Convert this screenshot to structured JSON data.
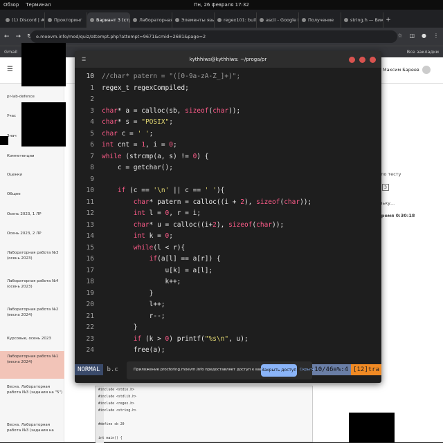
{
  "os": {
    "menu": "Обзор",
    "app": "Терминал",
    "clock": "Пн, 26 февраля 17:32"
  },
  "tabs": [
    {
      "label": "(1) Discord | #pr-2"
    },
    {
      "label": "Прокторинг"
    },
    {
      "label": "Вариант 3 (стр"
    },
    {
      "label": "Лабораторная"
    },
    {
      "label": "Элементы язы"
    },
    {
      "label": "regex101: build,"
    },
    {
      "label": "ascii - Google П"
    },
    {
      "label": "Получение"
    },
    {
      "label": "string.h — Вики"
    }
  ],
  "address": {
    "url": "e.moevm.info/mod/quiz/attempt.php?attempt=9671&cmid=2681&page=2"
  },
  "bookmarks": {
    "gmail": "Gmail",
    "all": "Все закладки"
  },
  "moodle": {
    "user": "Максим Бареев",
    "sidebar": [
      "pr-lab-defence",
      "Учас",
      "Знач",
      "Компетенции",
      "Оценки",
      "Общее",
      "Осень 2023, 1 ЛР",
      "Осень 2023, 2 ЛР",
      "Лабораторная работа №3 (осень 2023)",
      "Лабораторная работа №4 (осень 2023)",
      "Лабораторная работа №2 (весна 2024)",
      "Курсовые, осень 2023",
      "Лабораторная работа №1 (весна 2024)",
      "Весна. Лабораторная работа №3 (задания на \"5\")",
      "Весна. Лабораторная работа №3 (задания на"
    ],
    "right": {
      "l1": "ия по тесту",
      "l2": "3",
      "l3": "польку...",
      "l4": "е время 0:30:18"
    }
  },
  "terminal": {
    "title": "kythhiws@kythhiws: ~/proga/pr",
    "lines": [
      {
        "n": "10",
        "t": "//char* patern = \"([0-9a-zA-Z_]+)\";"
      },
      {
        "n": "1",
        "t": "regex_t regexCompiled;"
      },
      {
        "n": "2",
        "t": ""
      },
      {
        "n": "3",
        "t": "char* a = calloc(sb, sizeof(char));"
      },
      {
        "n": "4",
        "t": "char* s = \"POSIX\";"
      },
      {
        "n": "5",
        "t": "char c = ' ';"
      },
      {
        "n": "6",
        "t": "int cnt = 1, i = 0;"
      },
      {
        "n": "7",
        "t": "while (strcmp(a, s) != 0) {"
      },
      {
        "n": "8",
        "t": "    c = getchar();"
      },
      {
        "n": "9",
        "t": ""
      },
      {
        "n": "10",
        "t": "    if (c == '\\n' || c == ' '){"
      },
      {
        "n": "11",
        "t": "        char* patern = calloc((i + 2), sizeof(char));"
      },
      {
        "n": "12",
        "t": "        int l = 0, r = i;"
      },
      {
        "n": "13",
        "t": "        char* u = calloc((i+2), sizeof(char));"
      },
      {
        "n": "14",
        "t": "        int k = 0;"
      },
      {
        "n": "15",
        "t": "        while(l < r){"
      },
      {
        "n": "16",
        "t": "            if(a[l] == a[r]) {"
      },
      {
        "n": "17",
        "t": "                u[k] = a[l];"
      },
      {
        "n": "18",
        "t": "                k++;"
      },
      {
        "n": "19",
        "t": "            }"
      },
      {
        "n": "20",
        "t": "            l++;"
      },
      {
        "n": "21",
        "t": "            r--;"
      },
      {
        "n": "22",
        "t": "        }"
      },
      {
        "n": "23",
        "t": "        if (k > 0) printf(\"%s\\n\", u);"
      },
      {
        "n": "24",
        "t": "        free(a);"
      }
    ],
    "status": {
      "mode": "NORMAL",
      "file": "b.c",
      "ftype": "c",
      "enc": "utf-8",
      "pos": "21% ln:10/46≡%:4",
      "tr": "[12]tra"
    }
  },
  "ide": {
    "lines": [
      "#include <stdio.h>",
      "#include <stdlib.h>",
      "#include <regex.h>",
      "#include <string.h>",
      "",
      "#define sb 20",
      "",
      "int main() {"
    ]
  },
  "notification": {
    "text": "Приложение proctoring.moevm.info предоставляет доступ к вашему экрану.",
    "share": "Закрыть доступ",
    "hide": "Скрыть"
  }
}
